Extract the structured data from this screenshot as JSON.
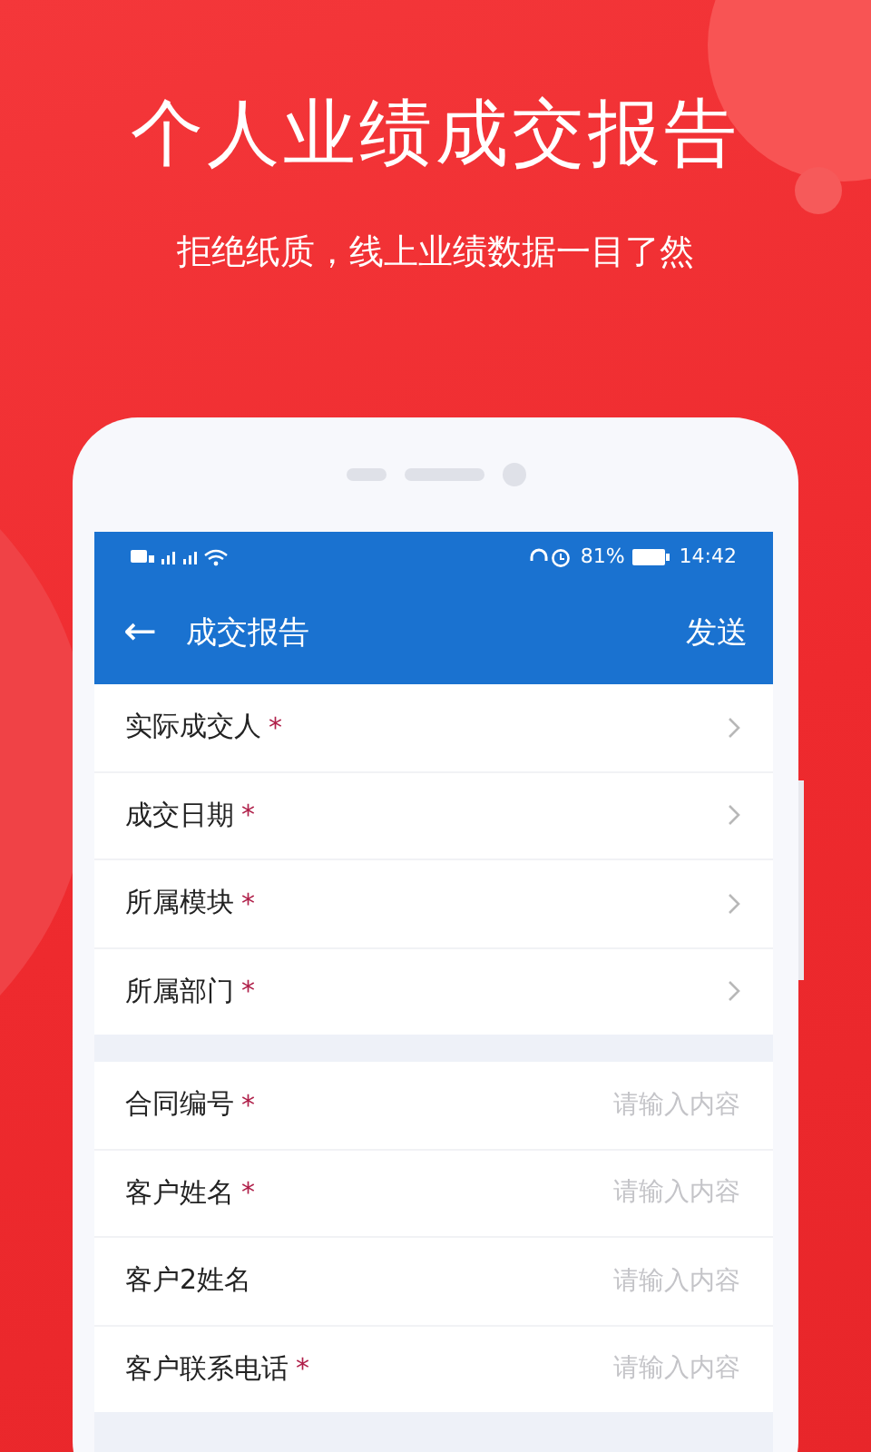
{
  "promo": {
    "headline": "个人业绩成交报告",
    "subtitle": "拒绝纸质，线上业绩数据一目了然"
  },
  "status_bar": {
    "battery": "81%",
    "time": "14:42"
  },
  "app_bar": {
    "back": "←",
    "title": "成交报告",
    "action": "发送"
  },
  "groups": [
    {
      "kind": "select",
      "rows": [
        {
          "label": "实际成交人",
          "required_mark": "*"
        },
        {
          "label": "成交日期",
          "required_mark": "*"
        },
        {
          "label": "所属模块",
          "required_mark": "*"
        },
        {
          "label": "所属部门",
          "required_mark": "*"
        }
      ]
    },
    {
      "kind": "input",
      "rows": [
        {
          "label": "合同编号",
          "required_mark": "*",
          "placeholder": "请输入内容"
        },
        {
          "label": "客户姓名",
          "required_mark": "*",
          "placeholder": "请输入内容"
        },
        {
          "label": "客户2姓名",
          "placeholder": "请输入内容"
        },
        {
          "label": "客户联系电话",
          "required_mark": "*",
          "placeholder": "请输入内容"
        }
      ]
    }
  ]
}
